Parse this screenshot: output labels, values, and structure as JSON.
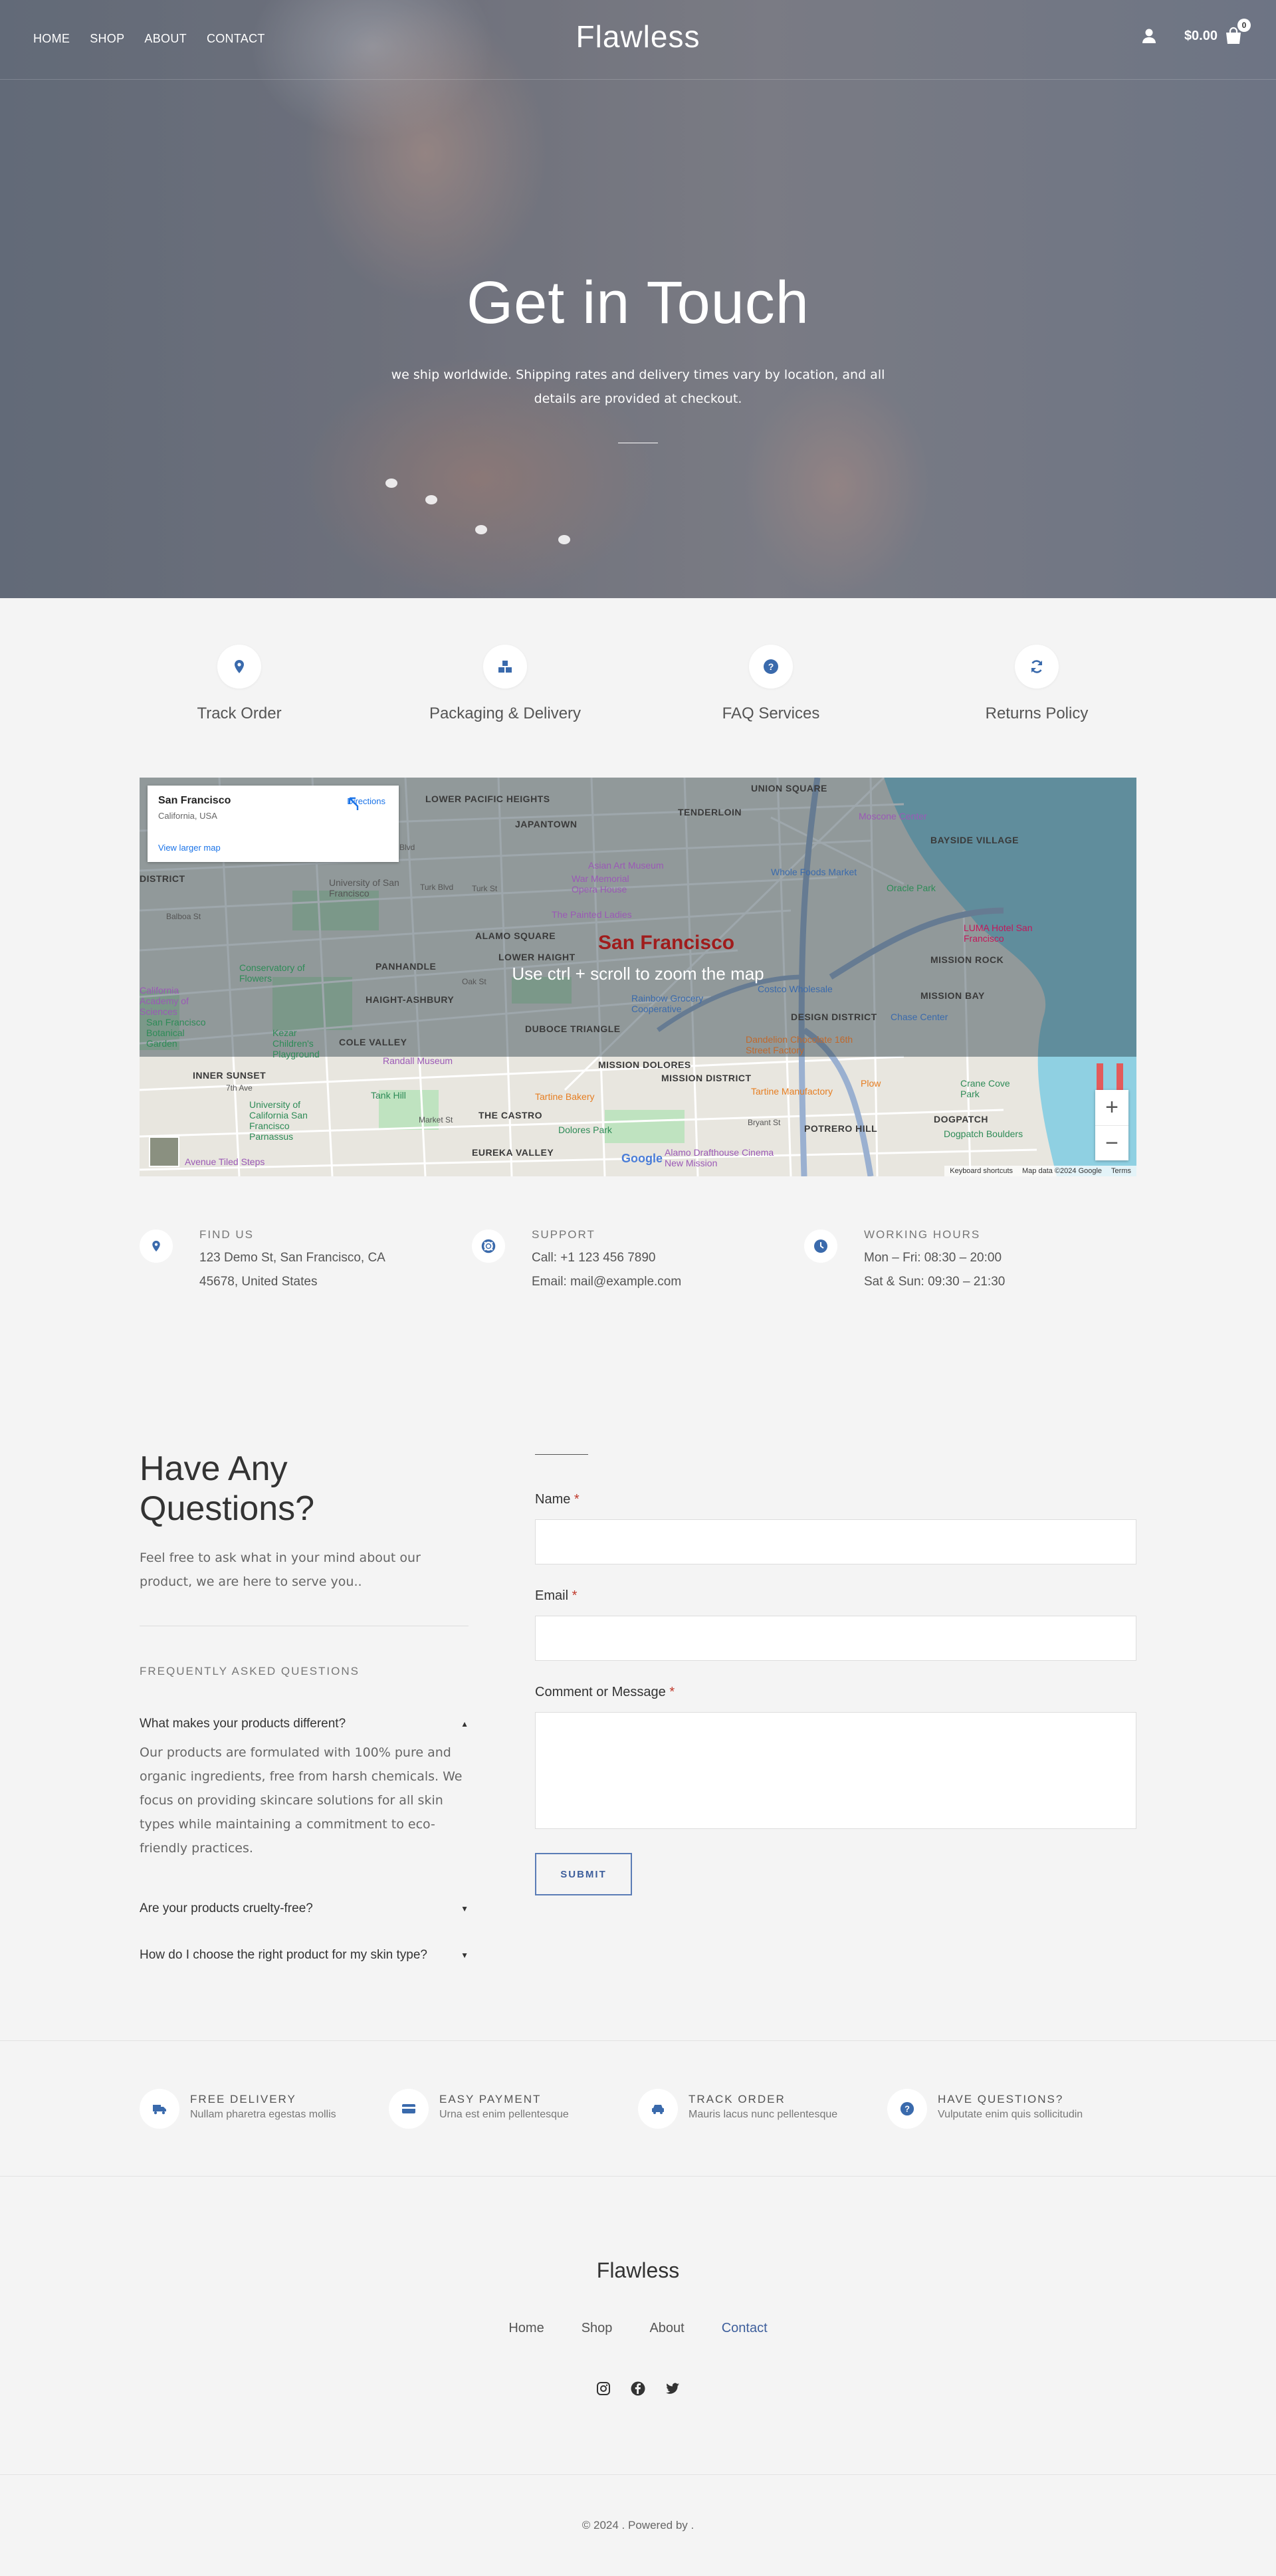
{
  "header": {
    "nav": [
      "HOME",
      "SHOP",
      "ABOUT",
      "CONTACT"
    ],
    "logo": "Flawless",
    "cart_total": "$0.00",
    "cart_count": "0"
  },
  "hero": {
    "title": "Get in Touch",
    "subtitle": "we ship worldwide. Shipping rates and delivery times vary by location, and all details are provided at checkout."
  },
  "services": [
    {
      "label": "Track Order",
      "icon": "location-pin-icon"
    },
    {
      "label": "Packaging & Delivery",
      "icon": "boxes-icon"
    },
    {
      "label": "FAQ Services",
      "icon": "question-icon"
    },
    {
      "label": "Returns Policy",
      "icon": "refresh-icon"
    }
  ],
  "map": {
    "place_title": "San Francisco",
    "place_sub": "California, USA",
    "directions": "Directions",
    "larger_map": "View larger map",
    "city_label": "San Francisco",
    "hint": "Use ctrl + scroll to zoom the map",
    "footer": [
      "Keyboard shortcuts",
      "Map data ©2024 Google",
      "Terms"
    ],
    "google": "Google",
    "labels": [
      "LOWER PACIFIC HEIGHTS",
      "JAPANTOWN",
      "TENDERLOIN",
      "UNION SQUARE",
      "BAYSIDE VILLAGE",
      "ALAMO SQUARE",
      "LOWER HAIGHT",
      "PANHANDLE",
      "HAIGHT-ASHBURY",
      "COLE VALLEY",
      "DUBOCE TRIANGLE",
      "MISSION DOLORES",
      "MISSION DISTRICT",
      "MISSION ROCK",
      "MISSION BAY",
      "DESIGN DISTRICT",
      "INNER SUNSET",
      "THE CASTRO",
      "EUREKA VALLEY",
      "POTRERO HILL",
      "DOGPATCH",
      "DISTRICT"
    ],
    "pois": [
      "Moscone Center",
      "Asian Art Museum",
      "War Memorial Opera House",
      "Whole Foods Market",
      "Oracle Park",
      "The Painted Ladies",
      "LUMA Hotel San Francisco",
      "California Academy of Sciences",
      "Conservatory of Flowers",
      "San Francisco Botanical Garden",
      "Kezar Children's Playground",
      "University of San Francisco",
      "Costco Wholesale",
      "Rainbow Grocery Cooperative",
      "Chase Center",
      "Dandelion Chocolate 16th Street Factory",
      "Randall Museum",
      "Tartine Bakery",
      "Tartine Manufactory",
      "Plow",
      "Crane Cove Park",
      "Tank Hill",
      "University of California San Francisco Parnassus",
      "Dolores Park",
      "Alamo Drafthouse Cinema New Mission",
      "Dogpatch Boulders",
      "Avenue Tiled Steps",
      "Geary Blvd",
      "Turk Blvd",
      "Balboa St",
      "Turk St",
      "Oak St",
      "Market St",
      "7th Ave",
      "Bryant St"
    ]
  },
  "contact_info": [
    {
      "heading": "FIND US",
      "lines": [
        "123 Demo St, San Francisco, CA",
        "45678, United States"
      ],
      "icon": "location-pin-icon"
    },
    {
      "heading": "SUPPORT",
      "lines": [
        "Call: +1 123 456 7890",
        "Email: mail@example.com"
      ],
      "icon": "lifebuoy-icon"
    },
    {
      "heading": "WORKING HOURS",
      "lines": [
        "Mon – Fri: 08:30 – 20:00",
        "Sat & Sun: 09:30 – 21:30"
      ],
      "icon": "clock-icon"
    }
  ],
  "questions": {
    "title": "Have Any Questions?",
    "intro": "Feel free to ask what in your mind about our product, we are here to serve you..",
    "faq_heading": "FREQUENTLY ASKED QUESTIONS",
    "faqs": [
      {
        "q": "What makes your products different?",
        "a": "Our products are formulated with 100% pure and organic ingredients, free from harsh chemicals. We focus on providing skincare solutions for all skin types while maintaining a commitment to eco-friendly practices.",
        "open": true
      },
      {
        "q": "Are your products cruelty-free?",
        "a": "",
        "open": false
      },
      {
        "q": "How do I choose the right product for my skin type?",
        "a": "",
        "open": false
      }
    ]
  },
  "form": {
    "name_label": "Name",
    "email_label": "Email",
    "message_label": "Comment or Message",
    "required_mark": "*",
    "submit": "SUBMIT"
  },
  "features": [
    {
      "title": "FREE DELIVERY",
      "sub": "Nullam pharetra egestas mollis",
      "icon": "truck-icon"
    },
    {
      "title": "EASY PAYMENT",
      "sub": "Urna est enim pellentesque",
      "icon": "credit-card-icon"
    },
    {
      "title": "TRACK ORDER",
      "sub": "Mauris lacus nunc pellentesque",
      "icon": "car-icon"
    },
    {
      "title": "HAVE QUESTIONS?",
      "sub": "Vulputate enim quis sollicitudin",
      "icon": "question-icon"
    }
  ],
  "footer": {
    "logo": "Flawless",
    "nav": [
      "Home",
      "Shop",
      "About",
      "Contact"
    ],
    "social": [
      "instagram-icon",
      "facebook-icon",
      "twitter-icon"
    ],
    "copyright": "© 2024 . Powered by ."
  },
  "colors": {
    "accent": "#3e5f9c",
    "icon_blue": "#3a6aac",
    "background": "#f4f4f4",
    "required": "#c0392b"
  }
}
